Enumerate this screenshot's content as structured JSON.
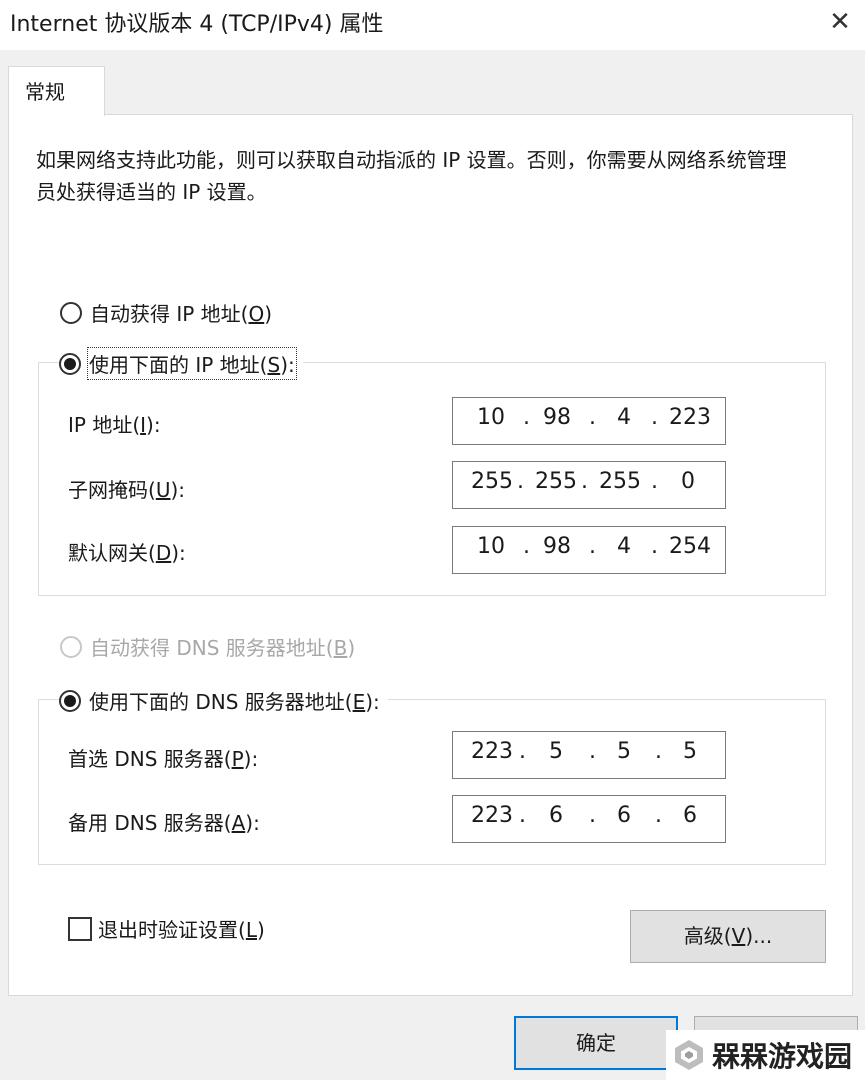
{
  "window": {
    "title": "Internet 协议版本 4 (TCP/IPv4) 属性",
    "close_glyph": "✕"
  },
  "tab": {
    "label": "常规"
  },
  "description": "如果网络支持此功能，则可以获取自动指派的 IP 设置。否则，你需要从网络系统管理员处获得适当的 IP 设置。",
  "ip": {
    "auto_radio": {
      "text": "自动获得 IP 地址(",
      "key": "O",
      "end": ")",
      "checked": false
    },
    "manual_radio": {
      "text": "使用下面的 IP 地址(",
      "key": "S",
      "end": "):",
      "checked": true
    },
    "fields": [
      {
        "label": "IP 地址(",
        "key": "I",
        "end": "):",
        "octets": [
          "10",
          "98",
          "4",
          "223"
        ]
      },
      {
        "label": "子网掩码(",
        "key": "U",
        "end": "):",
        "octets": [
          "255",
          "255",
          "255",
          "0"
        ]
      },
      {
        "label": "默认网关(",
        "key": "D",
        "end": "):",
        "octets": [
          "10",
          "98",
          "4",
          "254"
        ]
      }
    ]
  },
  "dns": {
    "auto_radio": {
      "text": "自动获得 DNS 服务器地址(",
      "key": "B",
      "end": ")",
      "checked": false,
      "disabled": true
    },
    "manual_radio": {
      "text": "使用下面的 DNS 服务器地址(",
      "key": "E",
      "end": "):",
      "checked": true
    },
    "fields": [
      {
        "label": "首选 DNS 服务器(",
        "key": "P",
        "end": "):",
        "octets": [
          "223",
          "5",
          "5",
          "5"
        ]
      },
      {
        "label": "备用 DNS 服务器(",
        "key": "A",
        "end": "):",
        "octets": [
          "223",
          "6",
          "6",
          "6"
        ]
      }
    ]
  },
  "validate_checkbox": {
    "text": "退出时验证设置(",
    "key": "L",
    "end": ")",
    "checked": false
  },
  "buttons": {
    "advanced": {
      "text": "高级(",
      "key": "V",
      "end": ")..."
    },
    "ok": "确定"
  },
  "watermark": {
    "text": "槑槑游戏园"
  },
  "colors": {
    "accent": "#0078d7",
    "background": "#f0f0f0",
    "panel": "#ffffff"
  }
}
